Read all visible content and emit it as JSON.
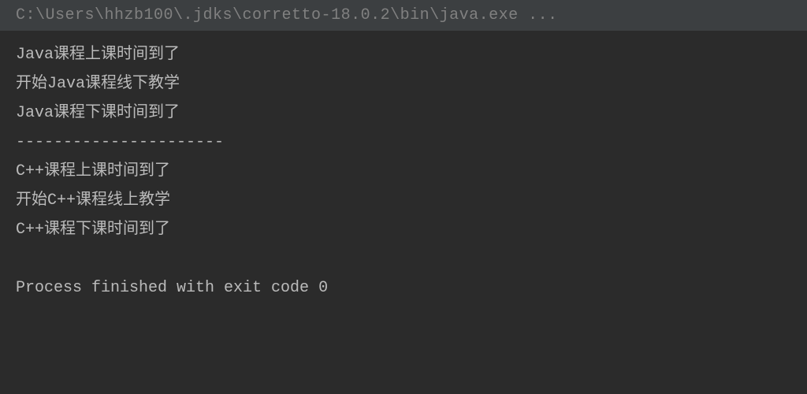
{
  "console": {
    "command": "C:\\Users\\hhzb100\\.jdks\\corretto-18.0.2\\bin\\java.exe ...",
    "output": [
      "Java课程上课时间到了",
      "开始Java课程线下教学",
      "Java课程下课时间到了",
      "----------------------",
      "C++课程上课时间到了",
      "开始C++课程线上教学",
      "C++课程下课时间到了"
    ],
    "exit_message": "Process finished with exit code 0"
  }
}
